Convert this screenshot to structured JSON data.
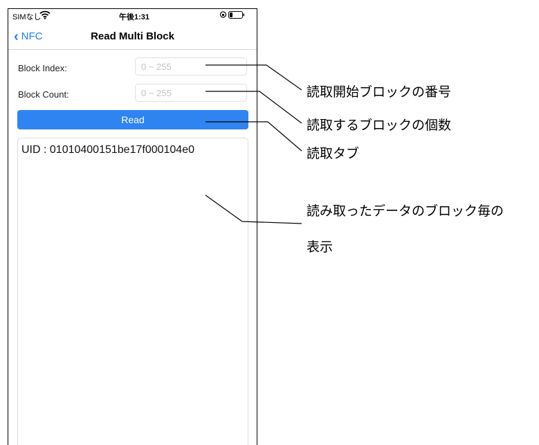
{
  "status_bar": {
    "carrier": "SIMなし",
    "time": "午後1:31"
  },
  "nav": {
    "back_label": "NFC",
    "title": "Read Multi Block"
  },
  "form": {
    "block_index_label": "Block Index:",
    "block_index_placeholder": "0 ~ 255",
    "block_count_label": "Block Count:",
    "block_count_placeholder": "0 ~ 255",
    "read_button": "Read"
  },
  "output": {
    "text": "UID : 01010400151be17f000104e0"
  },
  "annotations": {
    "start_block": "読取開始ブロックの番号",
    "block_count": "読取するブロックの個数",
    "read_tab": "読取タブ",
    "data_display_line1": "読み取ったデータのブロック毎の",
    "data_display_line2": "表示"
  },
  "colors": {
    "accent": "#1a7cf5",
    "button": "#2f84f1"
  },
  "icons": [
    "wifi-icon",
    "orientation-lock-icon",
    "battery-icon",
    "back-chevron-icon"
  ]
}
